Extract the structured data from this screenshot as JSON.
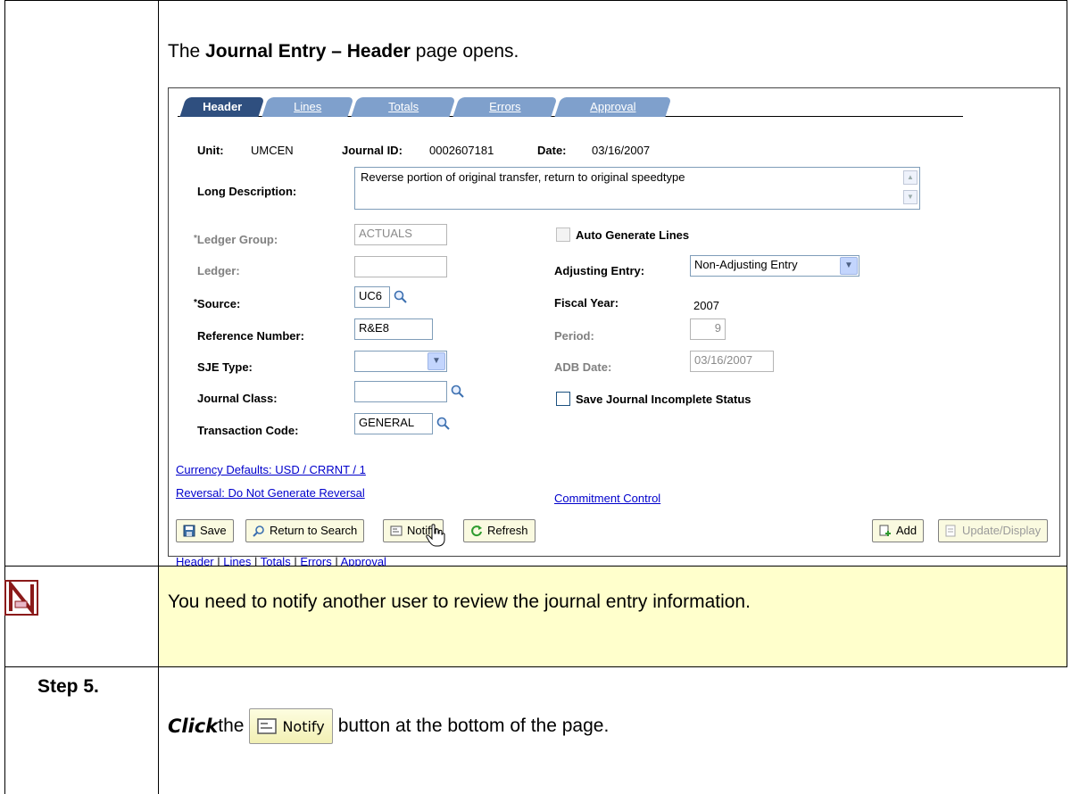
{
  "intro": {
    "prefix": "The ",
    "bold": "Journal Entry – Header",
    "suffix": " page opens."
  },
  "tabs": [
    {
      "label": "Header",
      "active": true
    },
    {
      "label": "Lines"
    },
    {
      "label": "Totals"
    },
    {
      "label": "Errors"
    },
    {
      "label": "Approval"
    }
  ],
  "header": {
    "unit_label": "Unit:",
    "unit_value": "UMCEN",
    "journal_id_label": "Journal ID:",
    "journal_id_value": "0002607181",
    "date_label": "Date:",
    "date_value": "03/16/2007"
  },
  "long_description": {
    "label": "Long Description:",
    "value": "Reverse portion of original transfer, return to original speedtype"
  },
  "form": {
    "ledger_group_label": "Ledger Group:",
    "ledger_group_value": "ACTUALS",
    "ledger_label": "Ledger:",
    "ledger_value": "",
    "source_label": "Source:",
    "source_value": "UC6",
    "reference_number_label": "Reference Number:",
    "reference_number_value": "R&E8",
    "sje_type_label": "SJE Type:",
    "sje_type_value": "",
    "journal_class_label": "Journal Class:",
    "journal_class_value": "",
    "transaction_code_label": "Transaction Code:",
    "transaction_code_value": "GENERAL",
    "auto_generate_label": "Auto Generate Lines",
    "adjusting_entry_label": "Adjusting Entry:",
    "adjusting_entry_value": "Non-Adjusting Entry",
    "fiscal_year_label": "Fiscal Year:",
    "fiscal_year_value": "2007",
    "period_label": "Period:",
    "period_value": "9",
    "adb_date_label": "ADB Date:",
    "adb_date_value": "03/16/2007",
    "save_incomplete_label": "Save Journal Incomplete Status"
  },
  "links": {
    "currency_defaults": "Currency Defaults: USD / CRRNT / 1",
    "reversal": "Reversal: Do Not Generate Reversal",
    "commitment_control": "Commitment Control"
  },
  "buttons": {
    "save": "Save",
    "return_to_search": "Return to Search",
    "notify": "Notify",
    "refresh": "Refresh",
    "add": "Add",
    "update_display": "Update/Display"
  },
  "bottom_nav": [
    "Header",
    "Lines",
    "Totals",
    "Errors",
    "Approval"
  ],
  "note": "You need to notify another user to review the journal entry information.",
  "step": {
    "label": "Step 5.",
    "click": "Click",
    "the": " the",
    "button_label": "Notify",
    "suffix": " button at the bottom of the page."
  },
  "colors": {
    "note_bg": "#ffffcc",
    "tab_active": "#2f4f7f",
    "tab_inactive": "#7fa0cc",
    "link": "#0000cc"
  }
}
